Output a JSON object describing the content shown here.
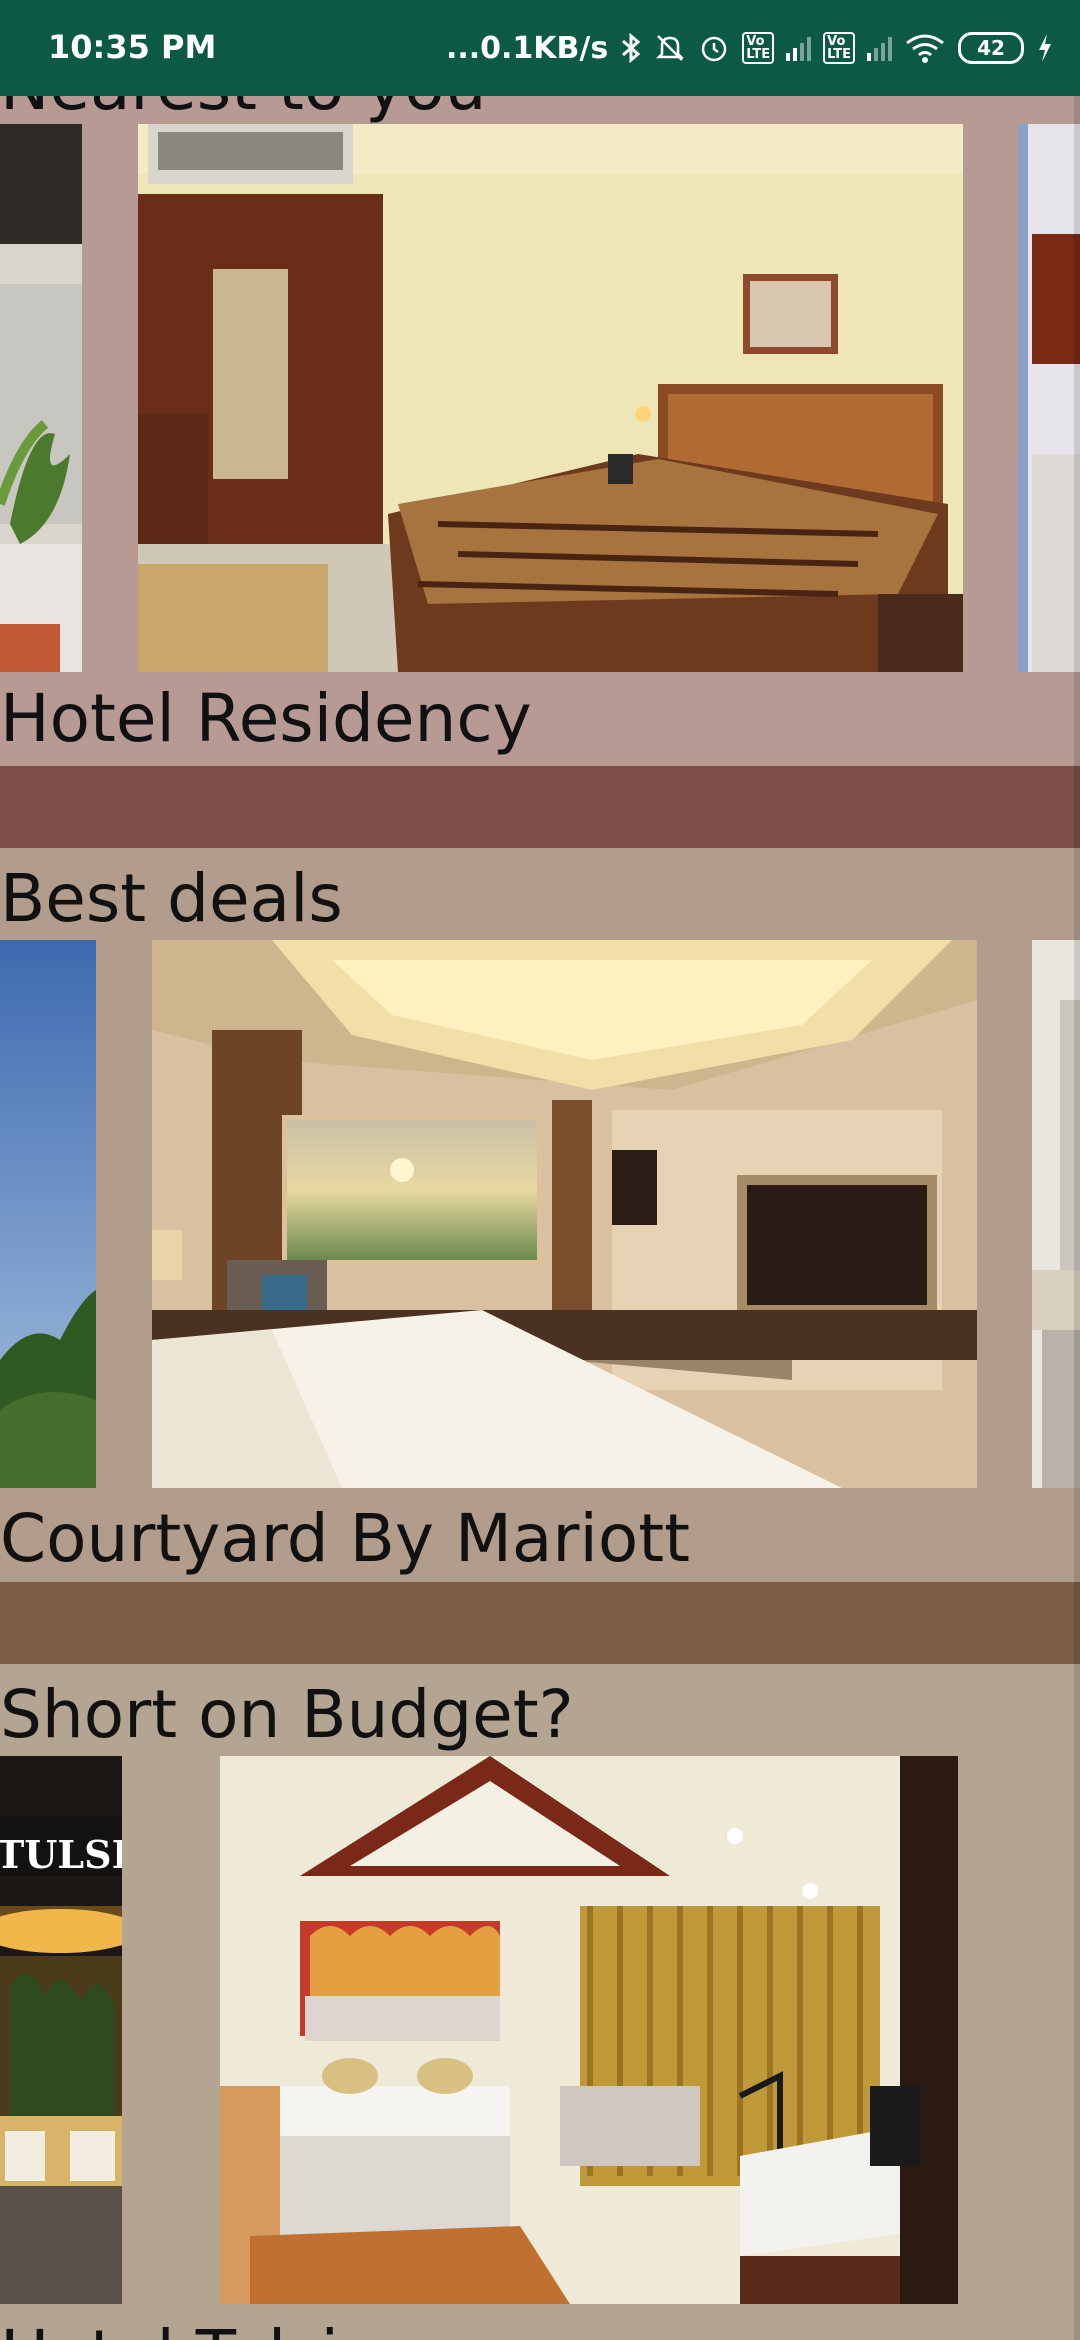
{
  "status_bar": {
    "time": "10:35 PM",
    "network_speed": "...0.1KB/s",
    "battery_level": "42",
    "icons": [
      "bluetooth-icon",
      "mute-icon",
      "alarm-icon",
      "volte-icon",
      "signal-icon",
      "volte-icon",
      "signal-icon",
      "wifi-icon",
      "battery-icon",
      "charging-icon"
    ],
    "volte_label": "Vo LTE"
  },
  "sections": [
    {
      "title": "Nearest to you",
      "card_name": "Hotel Residency",
      "background": "#b69a93",
      "divider_color": "#7d4f48"
    },
    {
      "title": "Best deals",
      "card_name": "Courtyard By Mariott",
      "background": "#b29d8d",
      "divider_color": "#7c5d45"
    },
    {
      "title": "Short on Budget?",
      "card_name": "Hotel Tulsi",
      "side_sign": "TULSI",
      "background": "#b3a592",
      "divider_color": "#7a6a52"
    }
  ]
}
